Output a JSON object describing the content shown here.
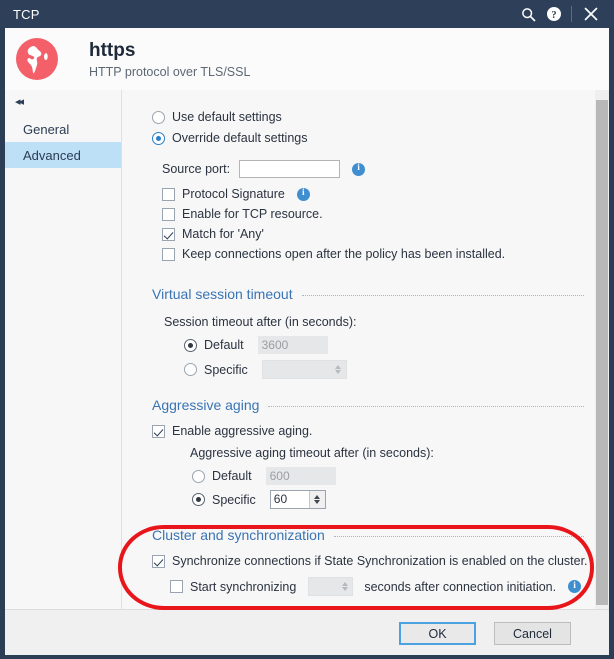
{
  "window": {
    "title": "TCP",
    "titlebar_icons": [
      "search-icon",
      "help-icon",
      "close-icon"
    ]
  },
  "header": {
    "icon": "globe-icon",
    "title": "https",
    "subtitle": "HTTP protocol over TLS/SSL"
  },
  "sidebar": {
    "collapse_glyph": "◂◂",
    "items": [
      {
        "label": "General",
        "active": false
      },
      {
        "label": "Advanced",
        "active": true
      }
    ]
  },
  "main": {
    "mode": {
      "use_default_label": "Use default settings",
      "use_default_selected": false,
      "override_label": "Override default settings",
      "override_selected": true
    },
    "source_port": {
      "label": "Source port:",
      "value": "",
      "placeholder": "",
      "info": "info-icon"
    },
    "options": [
      {
        "label": "Protocol Signature",
        "checked": false,
        "info": true
      },
      {
        "label": "Enable for TCP resource.",
        "checked": false,
        "info": false
      },
      {
        "label": "Match for 'Any'",
        "checked": true,
        "info": false
      },
      {
        "label": "Keep connections open after the policy has been installed.",
        "checked": false,
        "info": false
      }
    ],
    "virtual_session_timeout": {
      "heading": "Virtual session timeout",
      "sub_label": "Session timeout after (in seconds):",
      "default_label": "Default",
      "default_selected": true,
      "default_value": "3600",
      "specific_label": "Specific",
      "specific_selected": false,
      "specific_value": ""
    },
    "aggressive_aging": {
      "heading": "Aggressive aging",
      "enable_label": "Enable aggressive aging.",
      "enable_checked": true,
      "sub_label": "Aggressive aging timeout after (in seconds):",
      "default_label": "Default",
      "default_selected": false,
      "default_value": "600",
      "specific_label": "Specific",
      "specific_selected": true,
      "specific_value": "60"
    },
    "cluster_sync": {
      "heading": "Cluster and synchronization",
      "sync_label": "Synchronize connections if State Synchronization is enabled on the cluster.",
      "sync_checked": true,
      "start_sync_label": "Start synchronizing",
      "start_sync_checked": false,
      "start_sync_value": "",
      "after_label": "seconds after connection initiation.",
      "info": "info-icon"
    }
  },
  "footer": {
    "ok_label": "OK",
    "cancel_label": "Cancel"
  },
  "annotation": {
    "color": "#e8161a",
    "shape": "oval-highlight"
  },
  "colors": {
    "titlebar": "#2e4059",
    "accent_heading": "#3a74b4",
    "sidebar_active": "#bde0f7",
    "globe": "#f4606a",
    "info_blue": "#3f8ed0",
    "annotation_red": "#e8161a"
  }
}
